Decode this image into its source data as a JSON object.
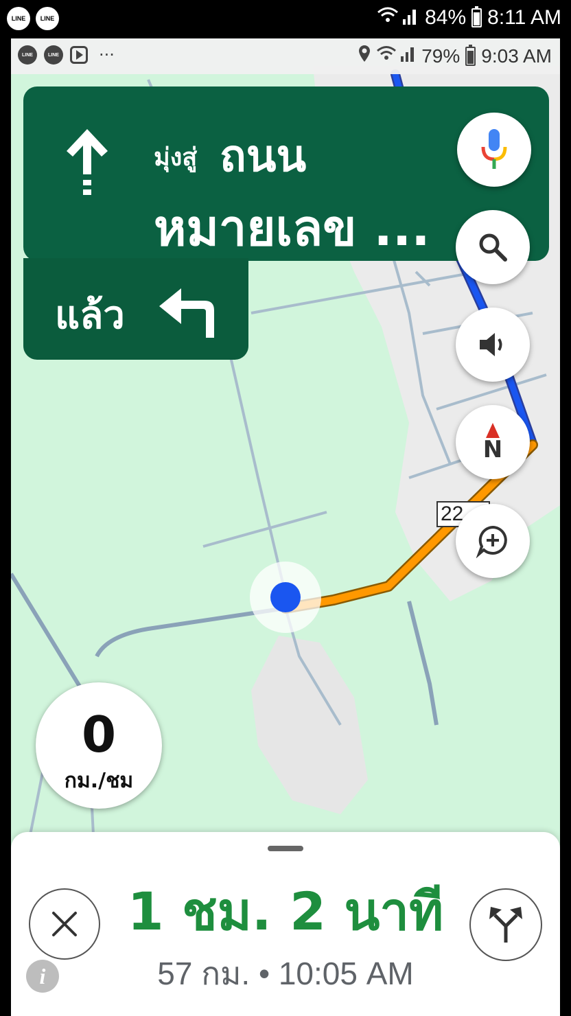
{
  "outer_status_bar": {
    "notification_icons": [
      "LINE",
      "LINE"
    ],
    "battery": "84%",
    "time": "8:11 AM"
  },
  "inner_status_bar": {
    "notification_icons": [
      "LINE",
      "LINE"
    ],
    "overflow": "···",
    "battery": "79%",
    "time": "9:03 AM"
  },
  "navigation": {
    "maneuver_icon": "straight-arrow-icon",
    "direction_prefix": "มุ่งสู่",
    "street_line1": "ถนน",
    "street_line2": "หมายเลข ...",
    "next_step_label": "แล้ว",
    "next_step_icon": "turn-left-icon"
  },
  "map": {
    "road_label": "22",
    "route_color": "#ff9800",
    "route_color_far": "#1a56f0",
    "location_color": "#1a56f0",
    "background_color": "#d1f5dc",
    "urban_color": "#ebebeb"
  },
  "speedometer": {
    "value": "0",
    "unit": "กม./ชม"
  },
  "trip_summary": {
    "duration": "1 ชม. 2 นาที",
    "distance_and_arrival": "57 กม. • 10:05 AM",
    "accent_color": "#1e8e3e"
  },
  "buttons": {
    "voice_search": "mic-icon",
    "search": "search-icon",
    "volume": "volume-icon",
    "compass": "N",
    "report": "add-comment-icon",
    "close": "close-icon",
    "alternate_routes": "alt-route-icon",
    "info": "i"
  }
}
